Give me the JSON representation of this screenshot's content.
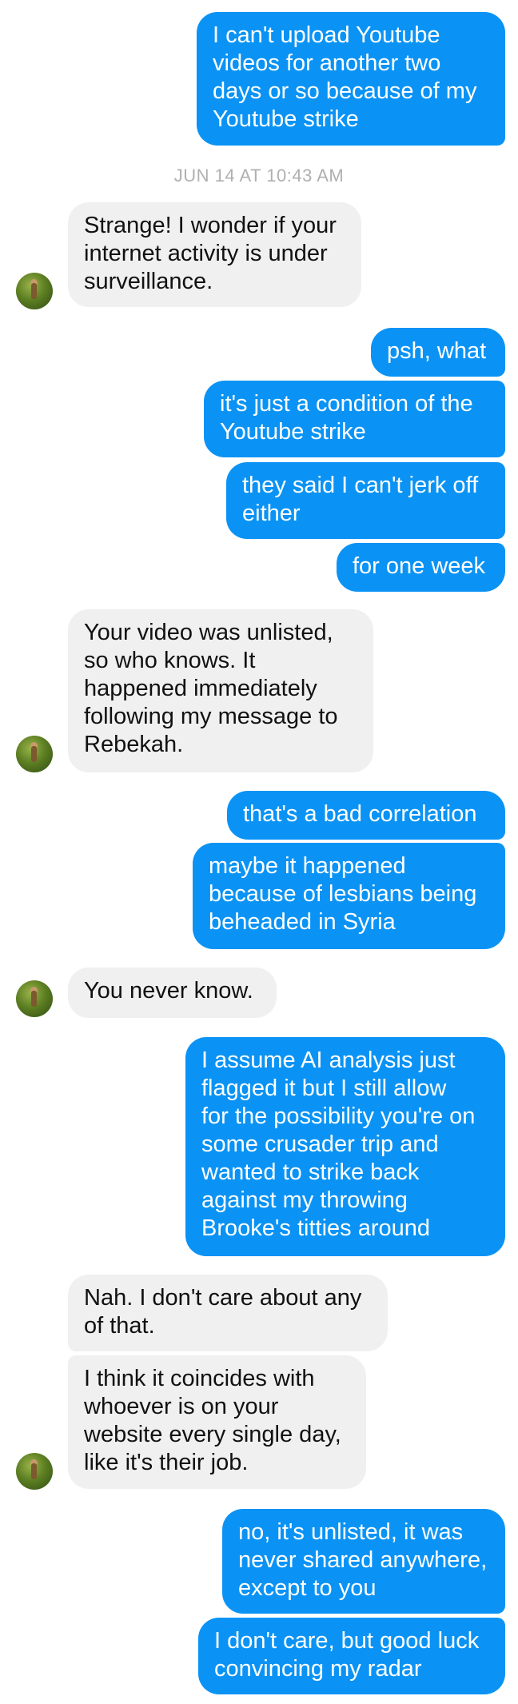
{
  "colors": {
    "outgoing_bubble": "#0a93f5",
    "incoming_bubble": "#f0f0f0",
    "timestamp": "#b0b0b0"
  },
  "timestamp": "JUN 14 AT 10:43 AM",
  "messages": [
    {
      "from": "me",
      "text": "I can't upload Youtube\nvideos for another two\ndays or so because of my\nYoutube strike"
    },
    {
      "from": "them",
      "text": "Strange! I wonder if your\ninternet activity is under\nsurveillance."
    },
    {
      "from": "me",
      "text": "psh, what"
    },
    {
      "from": "me",
      "text": "it's just a condition of the\nYoutube strike"
    },
    {
      "from": "me",
      "text": "they said I can't jerk off\neither"
    },
    {
      "from": "me",
      "text": "for one week"
    },
    {
      "from": "them",
      "text": "Your video was unlisted,\nso who knows. It\nhappened immediately\nfollowing my message to\nRebekah."
    },
    {
      "from": "me",
      "text": "that's a bad correlation"
    },
    {
      "from": "me",
      "text": "maybe it happened\nbecause of lesbians being\nbeheaded in Syria"
    },
    {
      "from": "them",
      "text": "You never know."
    },
    {
      "from": "me",
      "text": "I assume AI analysis just\nflagged it but I still allow\nfor the possibility you're on\nsome crusader trip and\nwanted to strike back\nagainst my throwing\nBrooke's titties around"
    },
    {
      "from": "them",
      "text": "Nah. I don't care about any\nof that."
    },
    {
      "from": "them",
      "text": "I think it coincides with\nwhoever is on your\nwebsite every single day,\nlike it's their job."
    },
    {
      "from": "me",
      "text": "no, it's unlisted, it was\nnever shared anywhere,\nexcept to you"
    },
    {
      "from": "me",
      "text": "I don't care, but good luck\nconvincing my radar"
    }
  ]
}
